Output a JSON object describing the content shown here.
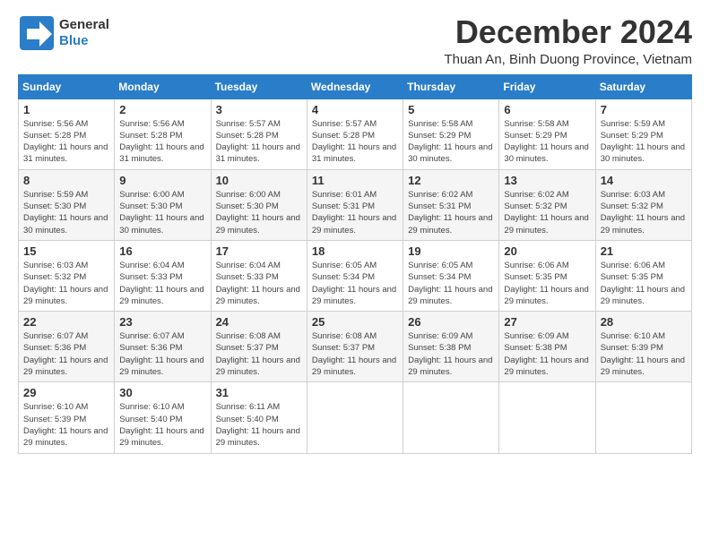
{
  "logo": {
    "text_general": "General",
    "text_blue": "Blue"
  },
  "title": {
    "month": "December 2024",
    "location": "Thuan An, Binh Duong Province, Vietnam"
  },
  "weekdays": [
    "Sunday",
    "Monday",
    "Tuesday",
    "Wednesday",
    "Thursday",
    "Friday",
    "Saturday"
  ],
  "weeks": [
    [
      {
        "day": 1,
        "sunrise": "5:56 AM",
        "sunset": "5:28 PM",
        "daylight": "11 hours and 31 minutes."
      },
      {
        "day": 2,
        "sunrise": "5:56 AM",
        "sunset": "5:28 PM",
        "daylight": "11 hours and 31 minutes."
      },
      {
        "day": 3,
        "sunrise": "5:57 AM",
        "sunset": "5:28 PM",
        "daylight": "11 hours and 31 minutes."
      },
      {
        "day": 4,
        "sunrise": "5:57 AM",
        "sunset": "5:28 PM",
        "daylight": "11 hours and 31 minutes."
      },
      {
        "day": 5,
        "sunrise": "5:58 AM",
        "sunset": "5:29 PM",
        "daylight": "11 hours and 30 minutes."
      },
      {
        "day": 6,
        "sunrise": "5:58 AM",
        "sunset": "5:29 PM",
        "daylight": "11 hours and 30 minutes."
      },
      {
        "day": 7,
        "sunrise": "5:59 AM",
        "sunset": "5:29 PM",
        "daylight": "11 hours and 30 minutes."
      }
    ],
    [
      {
        "day": 8,
        "sunrise": "5:59 AM",
        "sunset": "5:30 PM",
        "daylight": "11 hours and 30 minutes."
      },
      {
        "day": 9,
        "sunrise": "6:00 AM",
        "sunset": "5:30 PM",
        "daylight": "11 hours and 30 minutes."
      },
      {
        "day": 10,
        "sunrise": "6:00 AM",
        "sunset": "5:30 PM",
        "daylight": "11 hours and 29 minutes."
      },
      {
        "day": 11,
        "sunrise": "6:01 AM",
        "sunset": "5:31 PM",
        "daylight": "11 hours and 29 minutes."
      },
      {
        "day": 12,
        "sunrise": "6:02 AM",
        "sunset": "5:31 PM",
        "daylight": "11 hours and 29 minutes."
      },
      {
        "day": 13,
        "sunrise": "6:02 AM",
        "sunset": "5:32 PM",
        "daylight": "11 hours and 29 minutes."
      },
      {
        "day": 14,
        "sunrise": "6:03 AM",
        "sunset": "5:32 PM",
        "daylight": "11 hours and 29 minutes."
      }
    ],
    [
      {
        "day": 15,
        "sunrise": "6:03 AM",
        "sunset": "5:32 PM",
        "daylight": "11 hours and 29 minutes."
      },
      {
        "day": 16,
        "sunrise": "6:04 AM",
        "sunset": "5:33 PM",
        "daylight": "11 hours and 29 minutes."
      },
      {
        "day": 17,
        "sunrise": "6:04 AM",
        "sunset": "5:33 PM",
        "daylight": "11 hours and 29 minutes."
      },
      {
        "day": 18,
        "sunrise": "6:05 AM",
        "sunset": "5:34 PM",
        "daylight": "11 hours and 29 minutes."
      },
      {
        "day": 19,
        "sunrise": "6:05 AM",
        "sunset": "5:34 PM",
        "daylight": "11 hours and 29 minutes."
      },
      {
        "day": 20,
        "sunrise": "6:06 AM",
        "sunset": "5:35 PM",
        "daylight": "11 hours and 29 minutes."
      },
      {
        "day": 21,
        "sunrise": "6:06 AM",
        "sunset": "5:35 PM",
        "daylight": "11 hours and 29 minutes."
      }
    ],
    [
      {
        "day": 22,
        "sunrise": "6:07 AM",
        "sunset": "5:36 PM",
        "daylight": "11 hours and 29 minutes."
      },
      {
        "day": 23,
        "sunrise": "6:07 AM",
        "sunset": "5:36 PM",
        "daylight": "11 hours and 29 minutes."
      },
      {
        "day": 24,
        "sunrise": "6:08 AM",
        "sunset": "5:37 PM",
        "daylight": "11 hours and 29 minutes."
      },
      {
        "day": 25,
        "sunrise": "6:08 AM",
        "sunset": "5:37 PM",
        "daylight": "11 hours and 29 minutes."
      },
      {
        "day": 26,
        "sunrise": "6:09 AM",
        "sunset": "5:38 PM",
        "daylight": "11 hours and 29 minutes."
      },
      {
        "day": 27,
        "sunrise": "6:09 AM",
        "sunset": "5:38 PM",
        "daylight": "11 hours and 29 minutes."
      },
      {
        "day": 28,
        "sunrise": "6:10 AM",
        "sunset": "5:39 PM",
        "daylight": "11 hours and 29 minutes."
      }
    ],
    [
      {
        "day": 29,
        "sunrise": "6:10 AM",
        "sunset": "5:39 PM",
        "daylight": "11 hours and 29 minutes."
      },
      {
        "day": 30,
        "sunrise": "6:10 AM",
        "sunset": "5:40 PM",
        "daylight": "11 hours and 29 minutes."
      },
      {
        "day": 31,
        "sunrise": "6:11 AM",
        "sunset": "5:40 PM",
        "daylight": "11 hours and 29 minutes."
      },
      null,
      null,
      null,
      null
    ]
  ]
}
